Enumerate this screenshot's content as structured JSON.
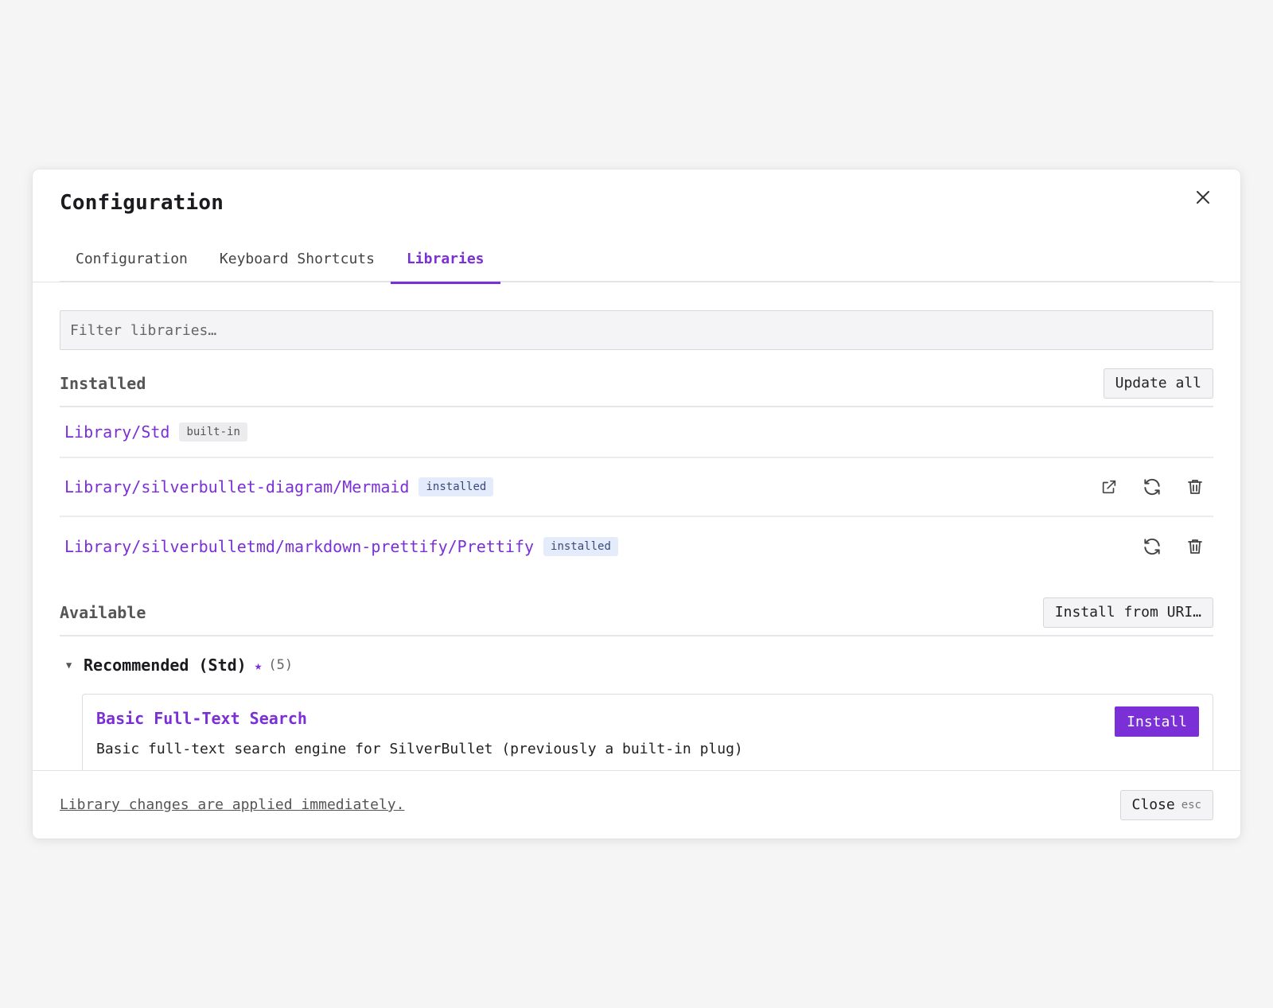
{
  "modal": {
    "title": "Configuration"
  },
  "tabs": [
    {
      "label": "Configuration"
    },
    {
      "label": "Keyboard Shortcuts"
    },
    {
      "label": "Libraries",
      "active": true
    }
  ],
  "filter": {
    "placeholder": "Filter libraries…",
    "value": ""
  },
  "installed": {
    "title": "Installed",
    "action_label": "Update all",
    "items": [
      {
        "name": "Library/Std",
        "badge": "built-in"
      },
      {
        "name": "Library/silverbullet-diagram/Mermaid",
        "badge": "installed",
        "icons": [
          "external-link-icon",
          "refresh-icon",
          "trash-icon"
        ]
      },
      {
        "name": "Library/silverbulletmd/markdown-prettify/Prettify",
        "badge": "installed",
        "icons": [
          "refresh-icon",
          "trash-icon"
        ]
      }
    ]
  },
  "available": {
    "title": "Available",
    "action_label": "Install from URI…",
    "groups": [
      {
        "title": "Recommended (Std)",
        "star": "★",
        "count": "(5)",
        "expanded": true,
        "items": [
          {
            "title": "Basic Full-Text Search",
            "description": "Basic full-text search engine for SilverBullet (previously a built-in plug)",
            "action_label": "Install"
          }
        ]
      }
    ]
  },
  "footer": {
    "note": "Library changes are applied immediately.",
    "close_label": "Close",
    "close_kbd": "esc"
  },
  "colors": {
    "accent": "#7b2fd6",
    "background": "#f5f5f6"
  }
}
